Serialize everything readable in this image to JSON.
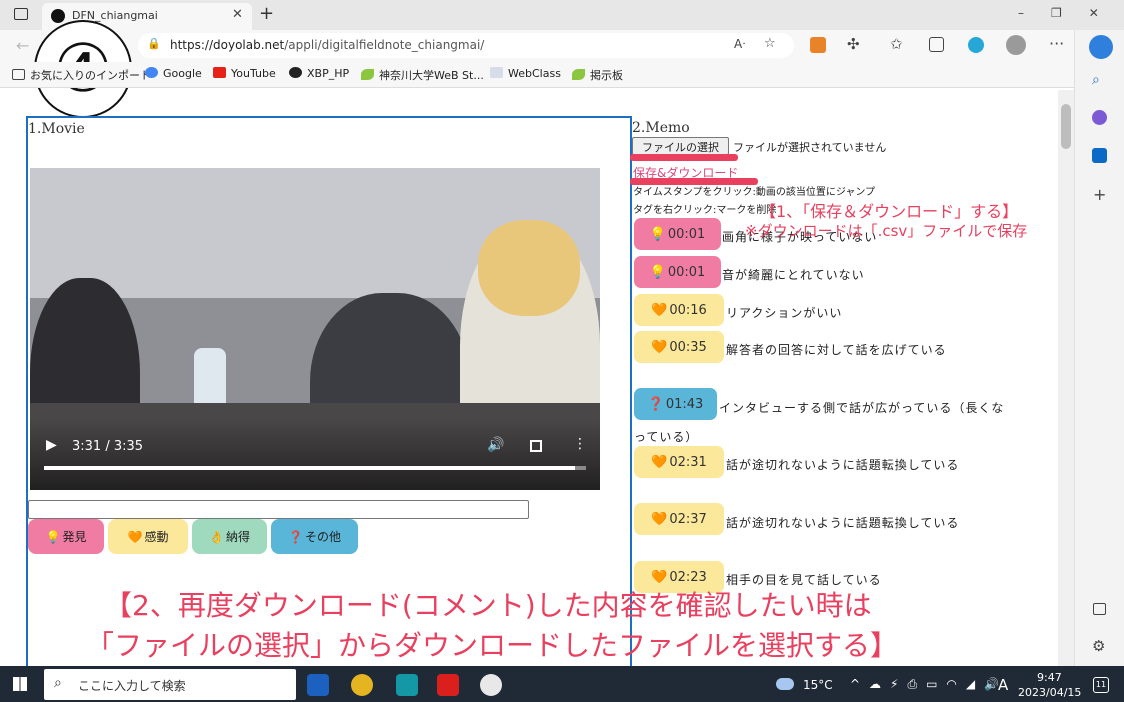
{
  "browser": {
    "tab_title": "DFN_chiangmai",
    "url_domain": "https://doyolab.net",
    "url_path": "/appli/digitalfieldnote_chiangmai/",
    "step_number": "④",
    "bookmarks": [
      "お気に入りのインポート",
      "Google",
      "YouTube",
      "XBP_HP",
      "神奈川大学WeB St...",
      "WebClass",
      "掲示板"
    ]
  },
  "movie": {
    "title": "1.Movie",
    "time": "3:31 / 3:35",
    "progress_fraction": 0.98
  },
  "categories": [
    {
      "icon": "💡",
      "label": "発見",
      "color": "#f07ca3"
    },
    {
      "icon": "🧡",
      "label": "感動",
      "color": "#fbe89a"
    },
    {
      "icon": "👌",
      "label": "納得",
      "color": "#9fd9be"
    },
    {
      "icon": "❓",
      "label": "その他",
      "color": "#5ab6d9"
    }
  ],
  "memo": {
    "title": "2.Memo",
    "file_button": "ファイルの選択",
    "file_status": "ファイルが選択されていません",
    "save_link": "保存&ダウンロード",
    "hint1": "タイムスタンプをクリック:動画の該当位置にジャンプ",
    "hint2": "タグを右クリック:マークを削除",
    "entries": [
      {
        "icon": "💡",
        "time": "00:01",
        "text": "画角に様子が映っていない"
      },
      {
        "icon": "💡",
        "time": "00:01",
        "text": "音が綺麗にとれていない"
      },
      {
        "icon": "🧡",
        "time": "00:16",
        "text": "リアクションがいい"
      },
      {
        "icon": "🧡",
        "time": "00:35",
        "text": "解答者の回答に対して話を広げている"
      },
      {
        "icon": "❓",
        "time": "01:43",
        "text": "インタビューする側で話が広がっている（長くな",
        "text2": "っている）"
      },
      {
        "icon": "🧡",
        "time": "02:31",
        "text": "話が途切れないように話題転換している"
      },
      {
        "icon": "🧡",
        "time": "02:37",
        "text": "話が途切れないように話題転換している"
      },
      {
        "icon": "🧡",
        "time": "02:23",
        "text": "相手の目を見て話している"
      }
    ]
  },
  "annotations": {
    "note1": "【1、「保存＆ダウンロード」する】",
    "note2": "※ダウンロードは「.csv」ファイルで保存",
    "note3": "【2、再度ダウンロード(コメント)した内容を確認したい時は",
    "note4": "「ファイルの選択」からダウンロードしたファイルを選択する】"
  },
  "taskbar": {
    "search_placeholder": "ここに入力して検索",
    "temperature": "15°C",
    "ime": "A",
    "time": "9:47",
    "date": "2023/04/15",
    "notification_count": "11"
  }
}
